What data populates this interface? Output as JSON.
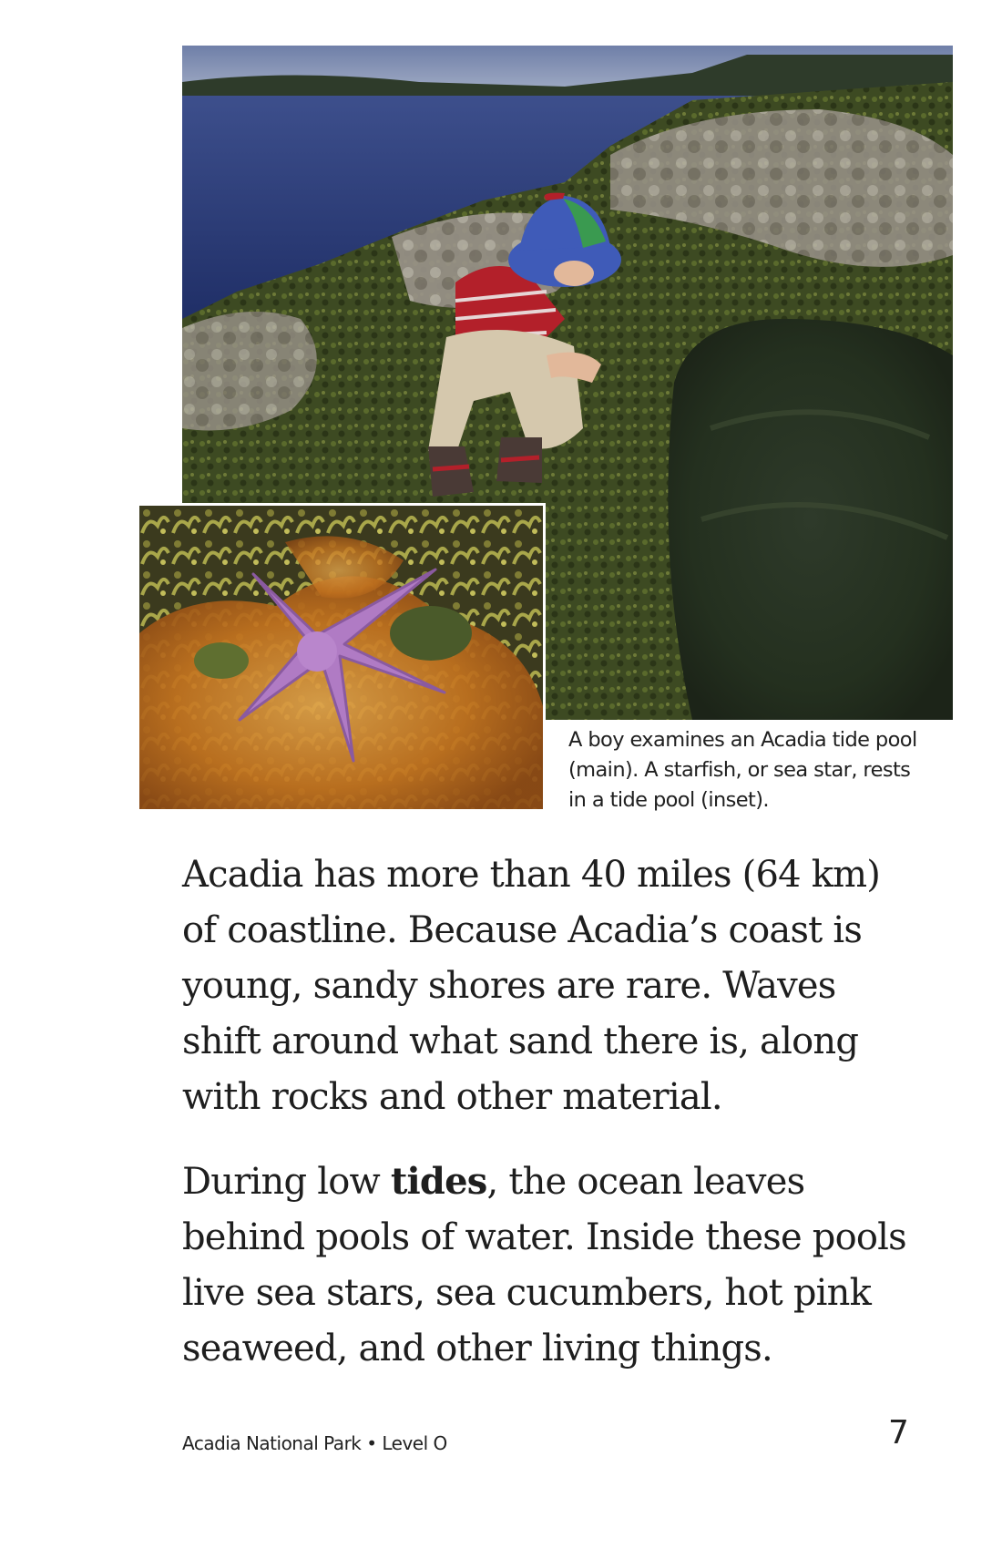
{
  "images": {
    "main": {
      "subject": "boy examining a tide pool on a rocky coast"
    },
    "inset": {
      "subject": "purple starfish resting in a tide pool"
    }
  },
  "caption": {
    "lines": [
      "A boy examines an Acadia tide pool",
      "(main). A starfish, or sea star, rests",
      "in a tide pool (inset)."
    ]
  },
  "paragraph1": {
    "lines": [
      "Acadia has more than 40 miles (64 km)",
      "of coastline. Because Acadia’s coast is",
      "young, sandy shores are rare. Waves",
      "shift around what sand there is, along",
      "with rocks and other material."
    ]
  },
  "paragraph2": {
    "line1_before": "During low ",
    "line1_bold": "tides",
    "line1_after": ", the ocean leaves",
    "lines": [
      "behind pools of water. Inside these pools",
      "live sea stars, sea cucumbers, hot pink",
      "seaweed, and other living things."
    ]
  },
  "footer": {
    "book_title": "Acadia National Park • Level O",
    "page_number": "7"
  }
}
